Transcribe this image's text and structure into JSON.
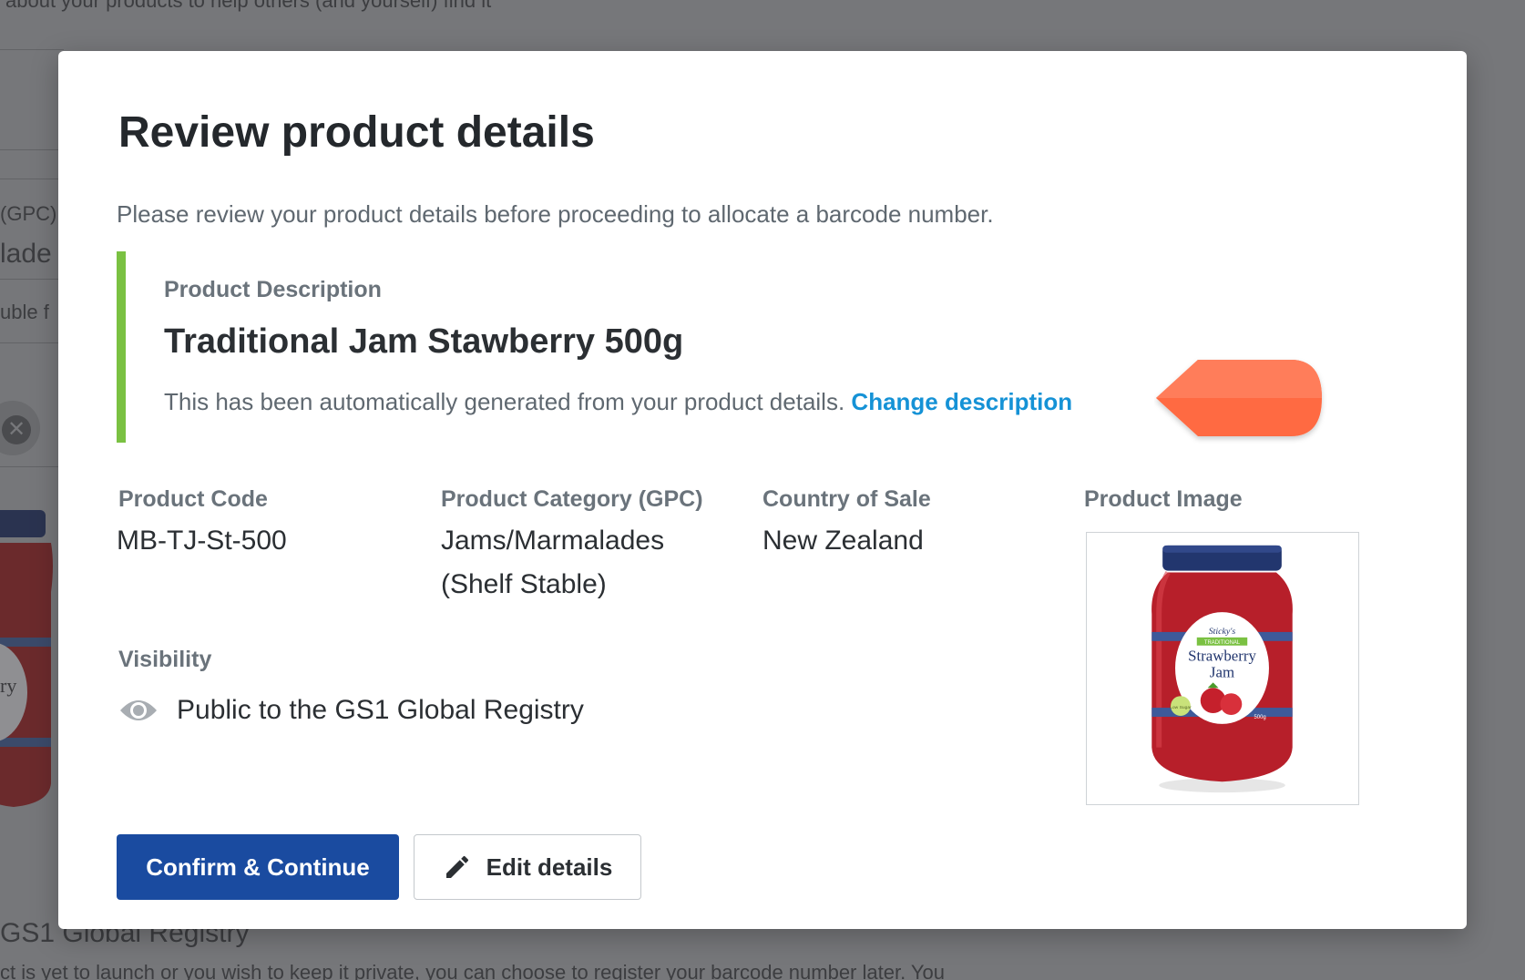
{
  "background": {
    "top_text": "about your products to help others (and yourself) find it",
    "gpc_fragment": "(GPC)",
    "lade_fragment": "lade",
    "uble_fragment": "uble f",
    "jar_fragment": "ry",
    "registry_fragment": "GS1 Global Registry",
    "bottom_text": "ct is yet to launch or you wish to keep it private, you can choose to register your barcode number later. You"
  },
  "modal": {
    "title": "Review product details",
    "intro": "Please review your product details before proceeding to allocate a barcode number.",
    "description": {
      "label": "Product Description",
      "value": "Traditional Jam Stawberry 500g",
      "note": "This has been automatically generated from your product details.",
      "change_link": "Change description"
    },
    "fields": {
      "code_label": "Product Code",
      "code_value": "MB-TJ-St-500",
      "category_label": "Product Category (GPC)",
      "category_value": "Jams/Marmalades (Shelf Stable)",
      "country_label": "Country of Sale",
      "country_value": "New Zealand",
      "image_label": "Product Image",
      "visibility_label": "Visibility",
      "visibility_value": "Public to the GS1 Global Registry"
    },
    "product_image": {
      "brand": "Sticky's",
      "ribbon": "TRADITIONAL",
      "name_line1": "Strawberry",
      "name_line2": "Jam",
      "badge": "Low Sugar",
      "weight": "500g"
    },
    "buttons": {
      "confirm": "Confirm & Continue",
      "edit": "Edit details"
    }
  },
  "colors": {
    "accent_green": "#7ac142",
    "link_blue": "#1592d6",
    "primary_button": "#1a4ba0",
    "pointer_orange": "#ff6a42"
  }
}
